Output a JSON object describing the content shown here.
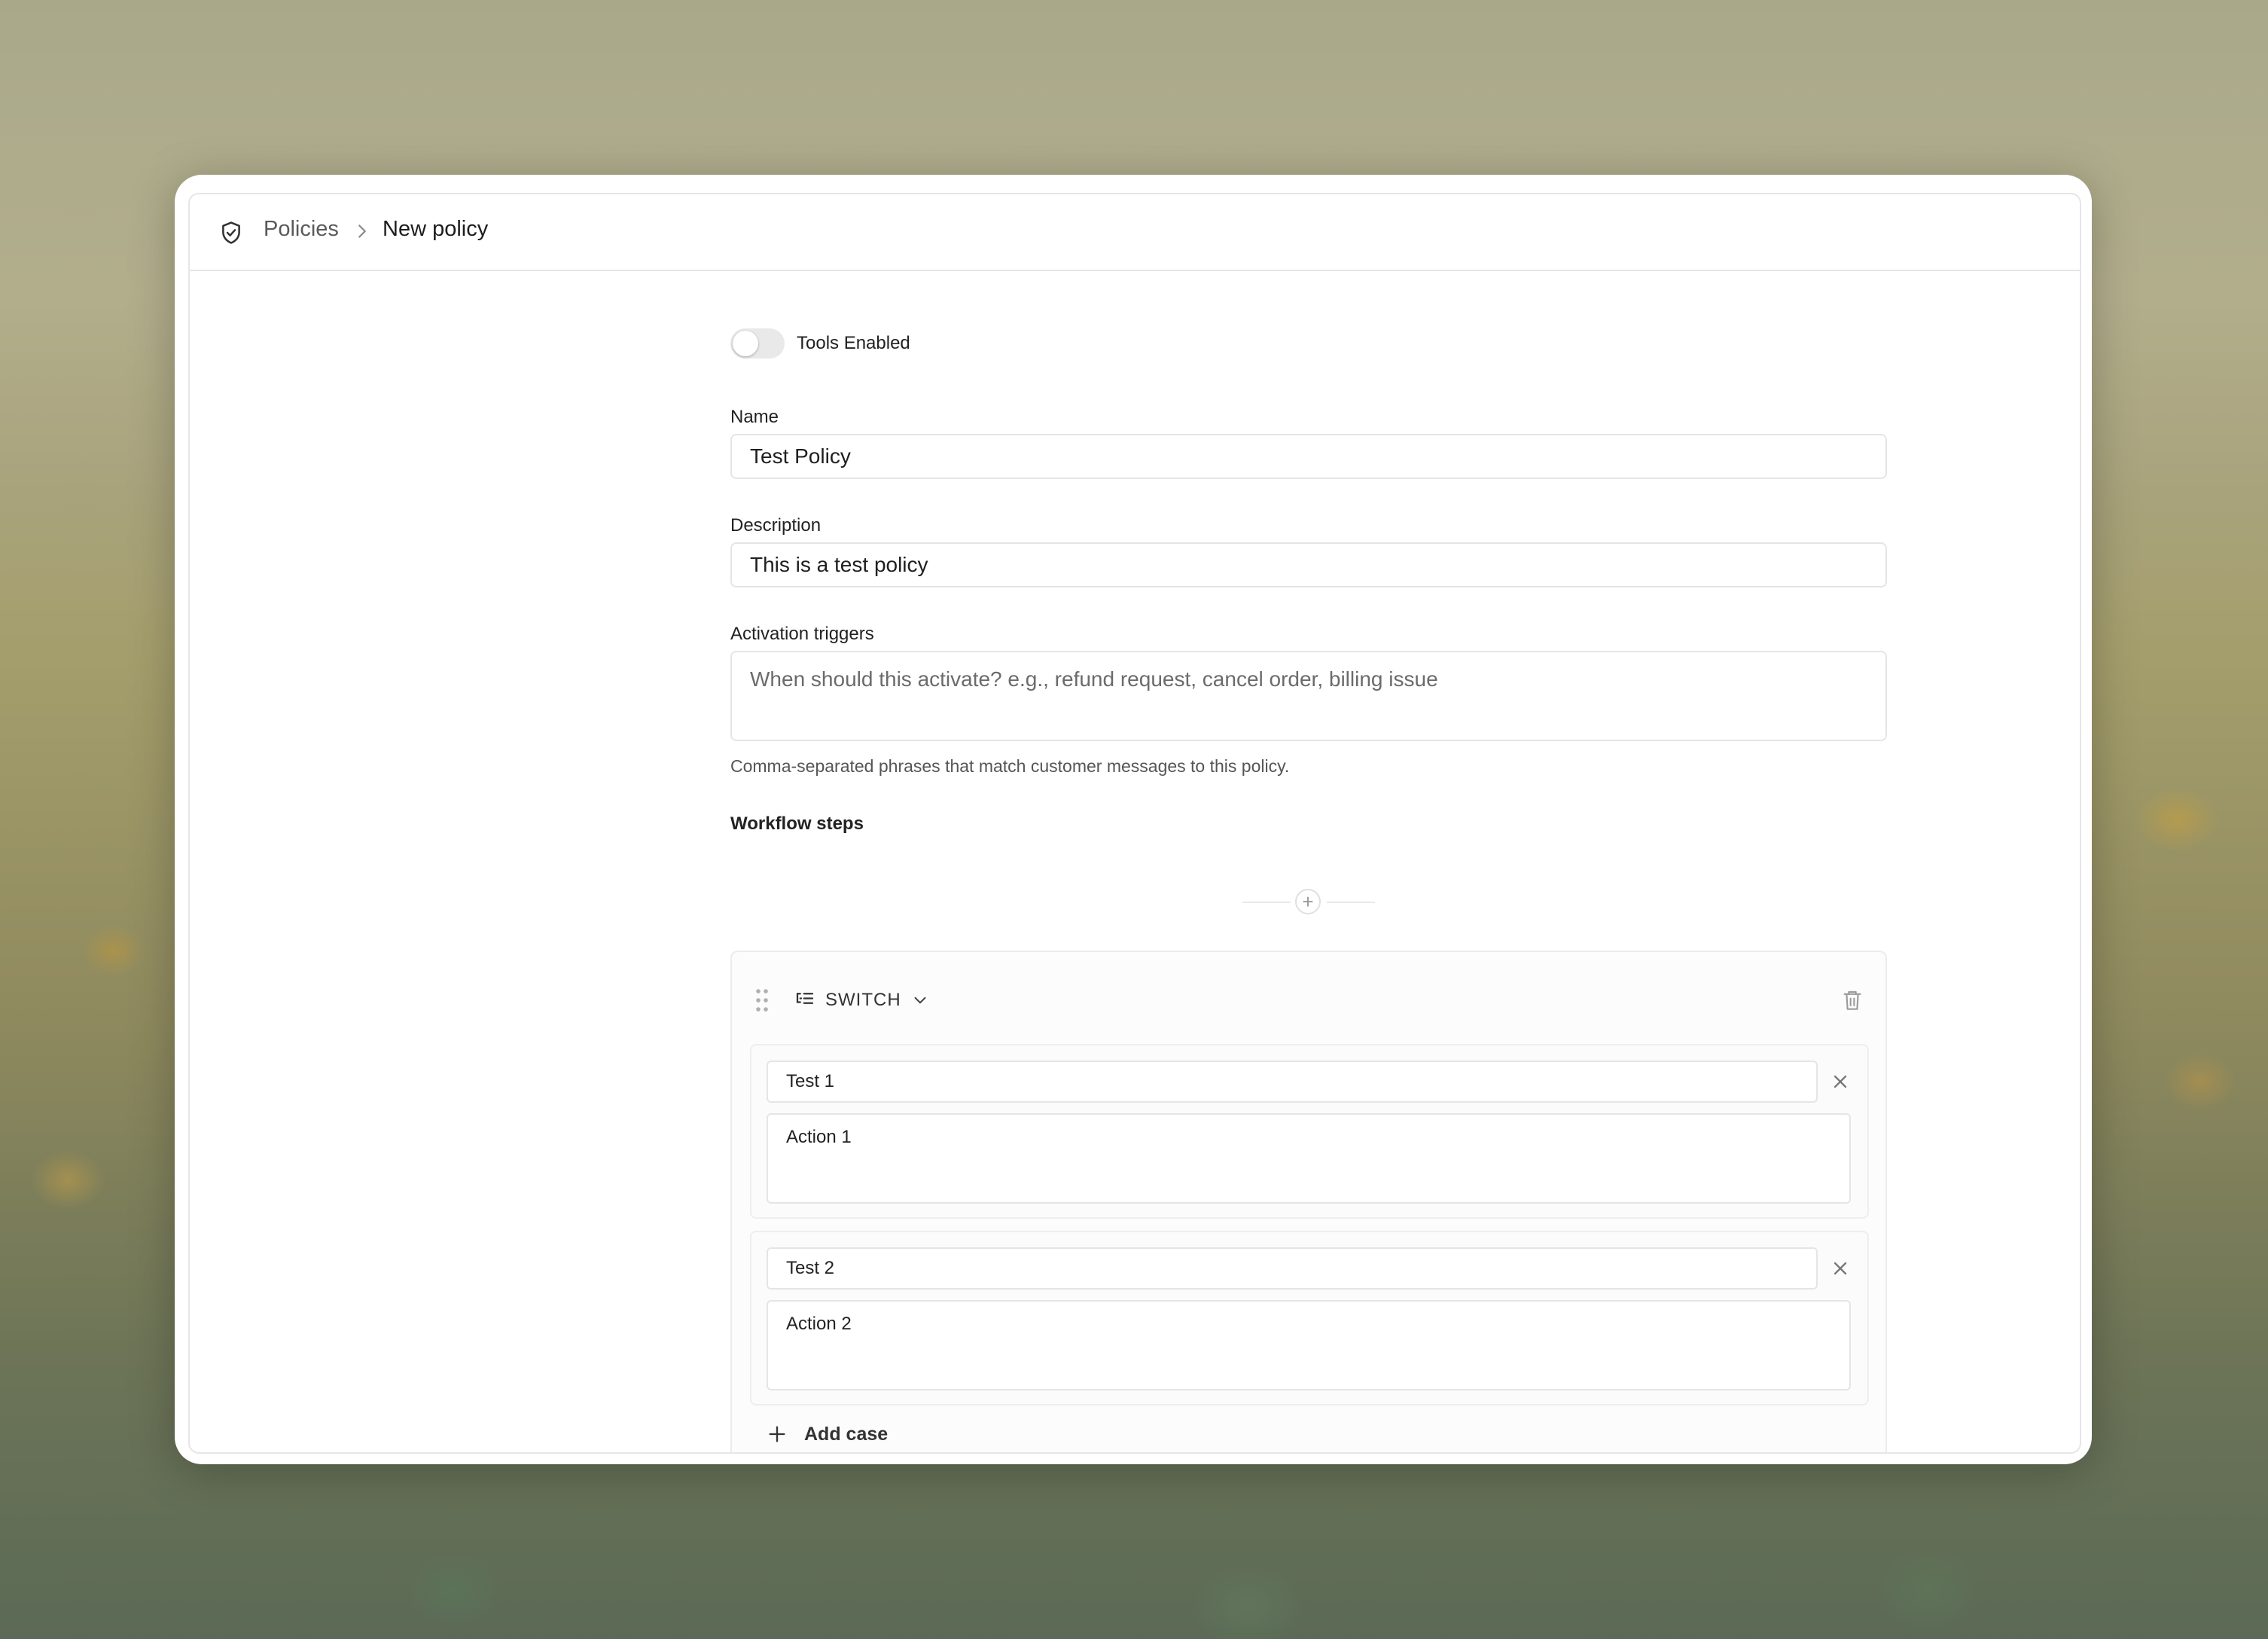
{
  "breadcrumb": {
    "icon": "shield-check-icon",
    "root": "Policies",
    "separator_icon": "chevron-right-icon",
    "current": "New policy"
  },
  "form": {
    "tools_toggle": {
      "label": "Tools Enabled",
      "enabled": false
    },
    "name": {
      "label": "Name",
      "value": "Test Policy"
    },
    "description": {
      "label": "Description",
      "value": "This is a test policy"
    },
    "activation_triggers": {
      "label": "Activation triggers",
      "value": "",
      "placeholder": "When should this activate? e.g., refund request, cancel order, billing issue",
      "helper": "Comma-separated phrases that match customer messages to this policy."
    },
    "workflow": {
      "label": "Workflow steps",
      "add_step_symbol": "+",
      "steps": [
        {
          "type_icon": "switch-list-icon",
          "type": "SWITCH",
          "cases": [
            {
              "condition": "Test 1",
              "action": "Action 1"
            },
            {
              "condition": "Test 2",
              "action": "Action 2"
            }
          ],
          "add_case_label": "Add case"
        }
      ]
    }
  }
}
